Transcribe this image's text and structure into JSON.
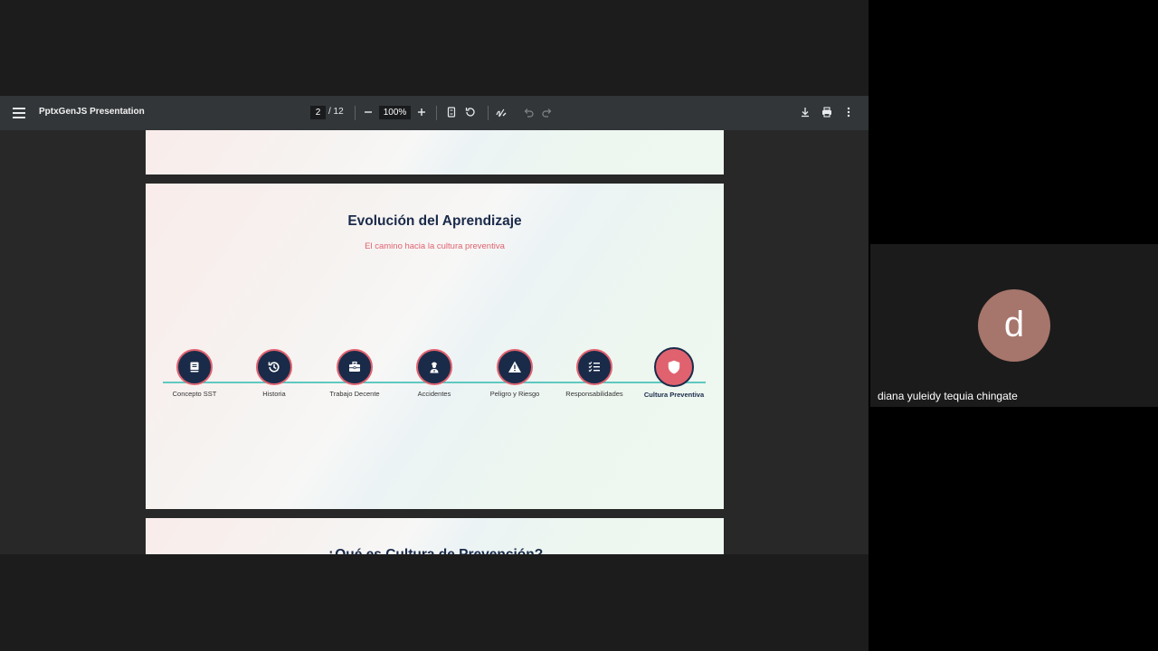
{
  "viewer": {
    "title": "PptxGenJS Presentation",
    "page_current": "2",
    "page_total": "/ 12",
    "zoom": "100%",
    "icons": [
      "menu-icon",
      "zoom-out-icon",
      "zoom-in-icon",
      "fit-page-icon",
      "rotate-icon",
      "annotate-icon",
      "undo-icon",
      "redo-icon",
      "download-icon",
      "print-icon",
      "more-icon"
    ]
  },
  "slide": {
    "title": "Evolución del Aprendizaje",
    "subtitle": "El camino hacia la cultura preventiva",
    "steps": [
      {
        "label": "Concepto SST",
        "icon": "book-icon"
      },
      {
        "label": "Historia",
        "icon": "history-icon"
      },
      {
        "label": "Trabajo Decente",
        "icon": "briefcase-icon"
      },
      {
        "label": "Accidentes",
        "icon": "injured-worker-icon"
      },
      {
        "label": "Peligro y Riesgo",
        "icon": "warning-icon"
      },
      {
        "label": "Responsabilidades",
        "icon": "checklist-icon"
      },
      {
        "label": "Cultura Preventiva",
        "icon": "shield-icon",
        "active": true
      }
    ]
  },
  "next_slide": {
    "title": "¿Qué es Cultura de Prevención?"
  },
  "participant": {
    "initial": "d",
    "name": "diana yuleidy tequia chingate",
    "avatar_color": "#a6756b"
  },
  "colors": {
    "navy": "#1a2b49",
    "coral": "#e0626f",
    "teal": "#5fc9c0"
  }
}
